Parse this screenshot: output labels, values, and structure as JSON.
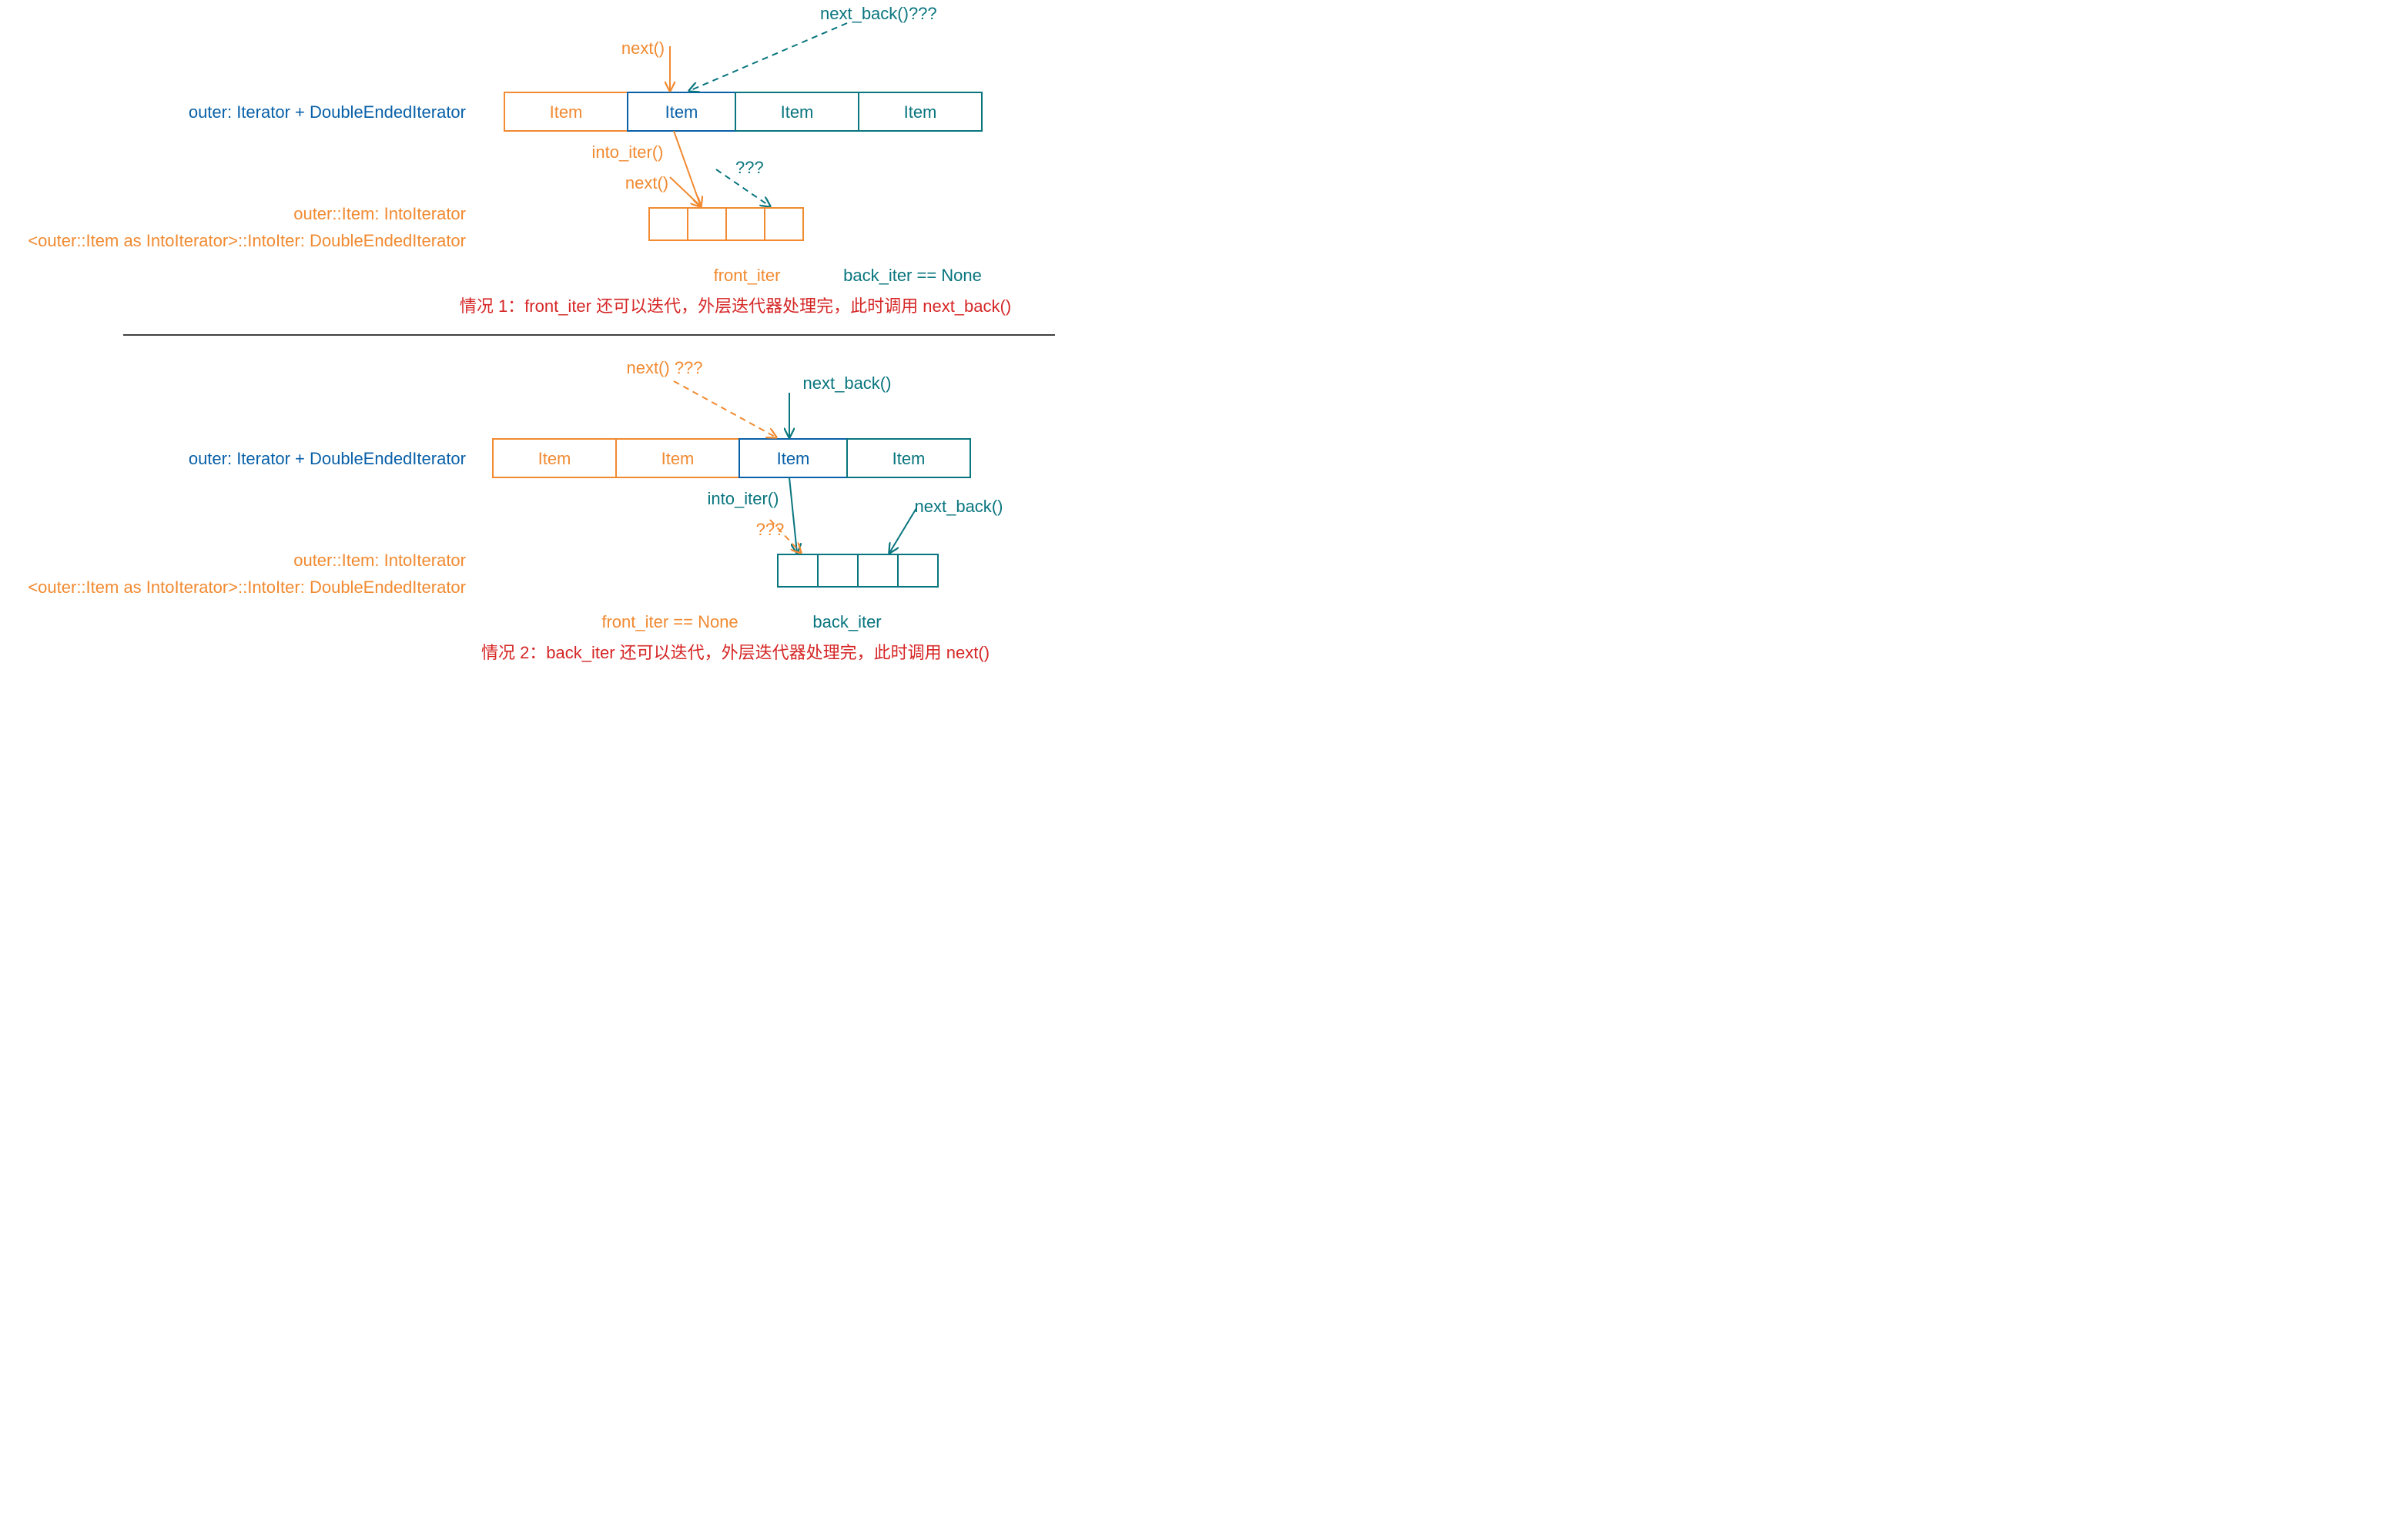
{
  "colors": {
    "blue": "#0860A8",
    "orange": "#F18A31",
    "teal": "#09757E",
    "red": "#D62626",
    "black": "#000"
  },
  "labels": {
    "outer_type": "outer: Iterator + DoubleEndedIterator",
    "outer_item": "outer::Item: IntoIterator",
    "outer_intoiter": "<outer::Item as IntoIterator>::IntoIter: DoubleEndedIterator",
    "item": "Item",
    "next": "next()",
    "next_back": "next_back()",
    "next_q": "next() ???",
    "next_back_q": "next_back()???",
    "into_iter": "into_iter()",
    "qqq": "???",
    "front_iter": "front_iter",
    "back_iter": "back_iter",
    "back_none": "back_iter == None",
    "front_none": "front_iter == None"
  },
  "case1": {
    "caption": "情况 1：front_iter 还可以迭代，外层迭代器处理完，此时调用 next_back()"
  },
  "case2": {
    "caption": "情况 2：back_iter 还可以迭代，外层迭代器处理完，此时调用 next()"
  }
}
